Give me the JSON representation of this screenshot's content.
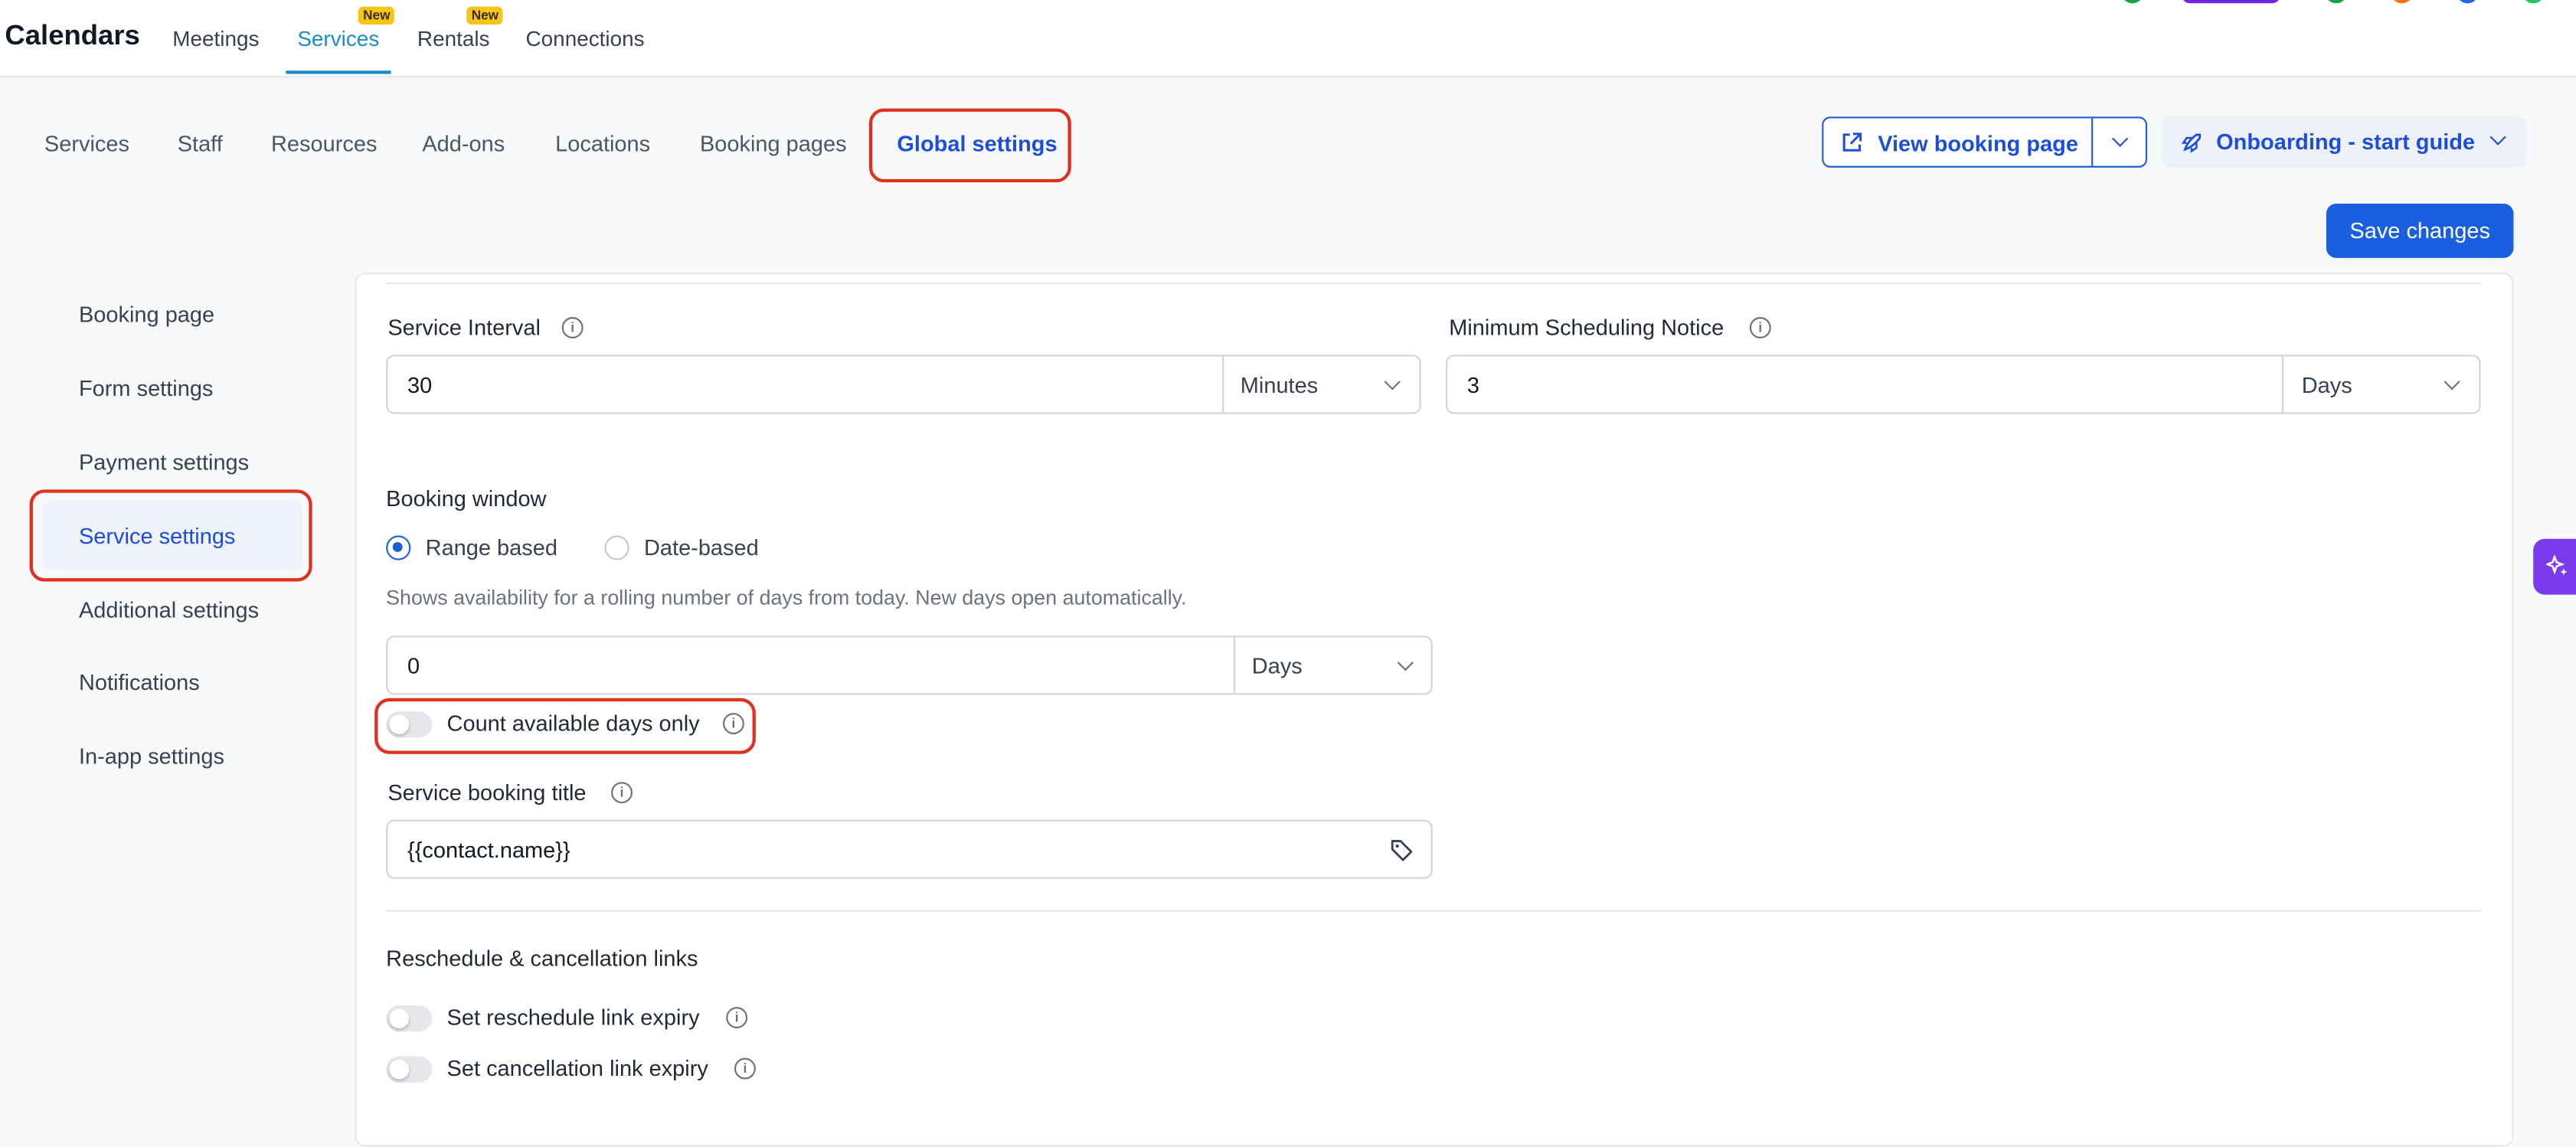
{
  "app": {
    "title": "Calendars"
  },
  "topnav": {
    "items": [
      {
        "label": "Meetings"
      },
      {
        "label": "Services",
        "badge": "New",
        "active": true
      },
      {
        "label": "Rentals",
        "badge": "New"
      },
      {
        "label": "Connections"
      }
    ]
  },
  "subnav": {
    "items": [
      "Services",
      "Staff",
      "Resources",
      "Add-ons",
      "Locations",
      "Booking pages",
      "Global settings"
    ],
    "active": "Global settings"
  },
  "actions": {
    "view_booking_page": "View booking page",
    "onboarding": "Onboarding - start guide",
    "save": "Save changes"
  },
  "leftnav": {
    "items": [
      "Booking page",
      "Form settings",
      "Payment settings",
      "Service settings",
      "Additional settings",
      "Notifications",
      "In-app settings"
    ],
    "active": "Service settings"
  },
  "form": {
    "service_interval": {
      "label": "Service Interval",
      "value": "30",
      "unit": "Minutes"
    },
    "min_notice": {
      "label": "Minimum Scheduling Notice",
      "value": "3",
      "unit": "Days"
    },
    "booking_window": {
      "title": "Booking window",
      "options": [
        "Range based",
        "Date-based"
      ],
      "selected": "Range based",
      "helper": "Shows availability for a rolling number of days from today. New days open automatically.",
      "value": "0",
      "unit": "Days",
      "count_available_label": "Count available days only"
    },
    "booking_title": {
      "label": "Service booking title",
      "value": "{{contact.name}}"
    },
    "reschedule": {
      "title": "Reschedule & cancellation links",
      "reschedule_label": "Set reschedule link expiry",
      "cancellation_label": "Set cancellation link expiry"
    }
  },
  "colors": {
    "accent": "#1d4ed8",
    "highlight": "#e0301e",
    "badge": "#f5c518"
  }
}
